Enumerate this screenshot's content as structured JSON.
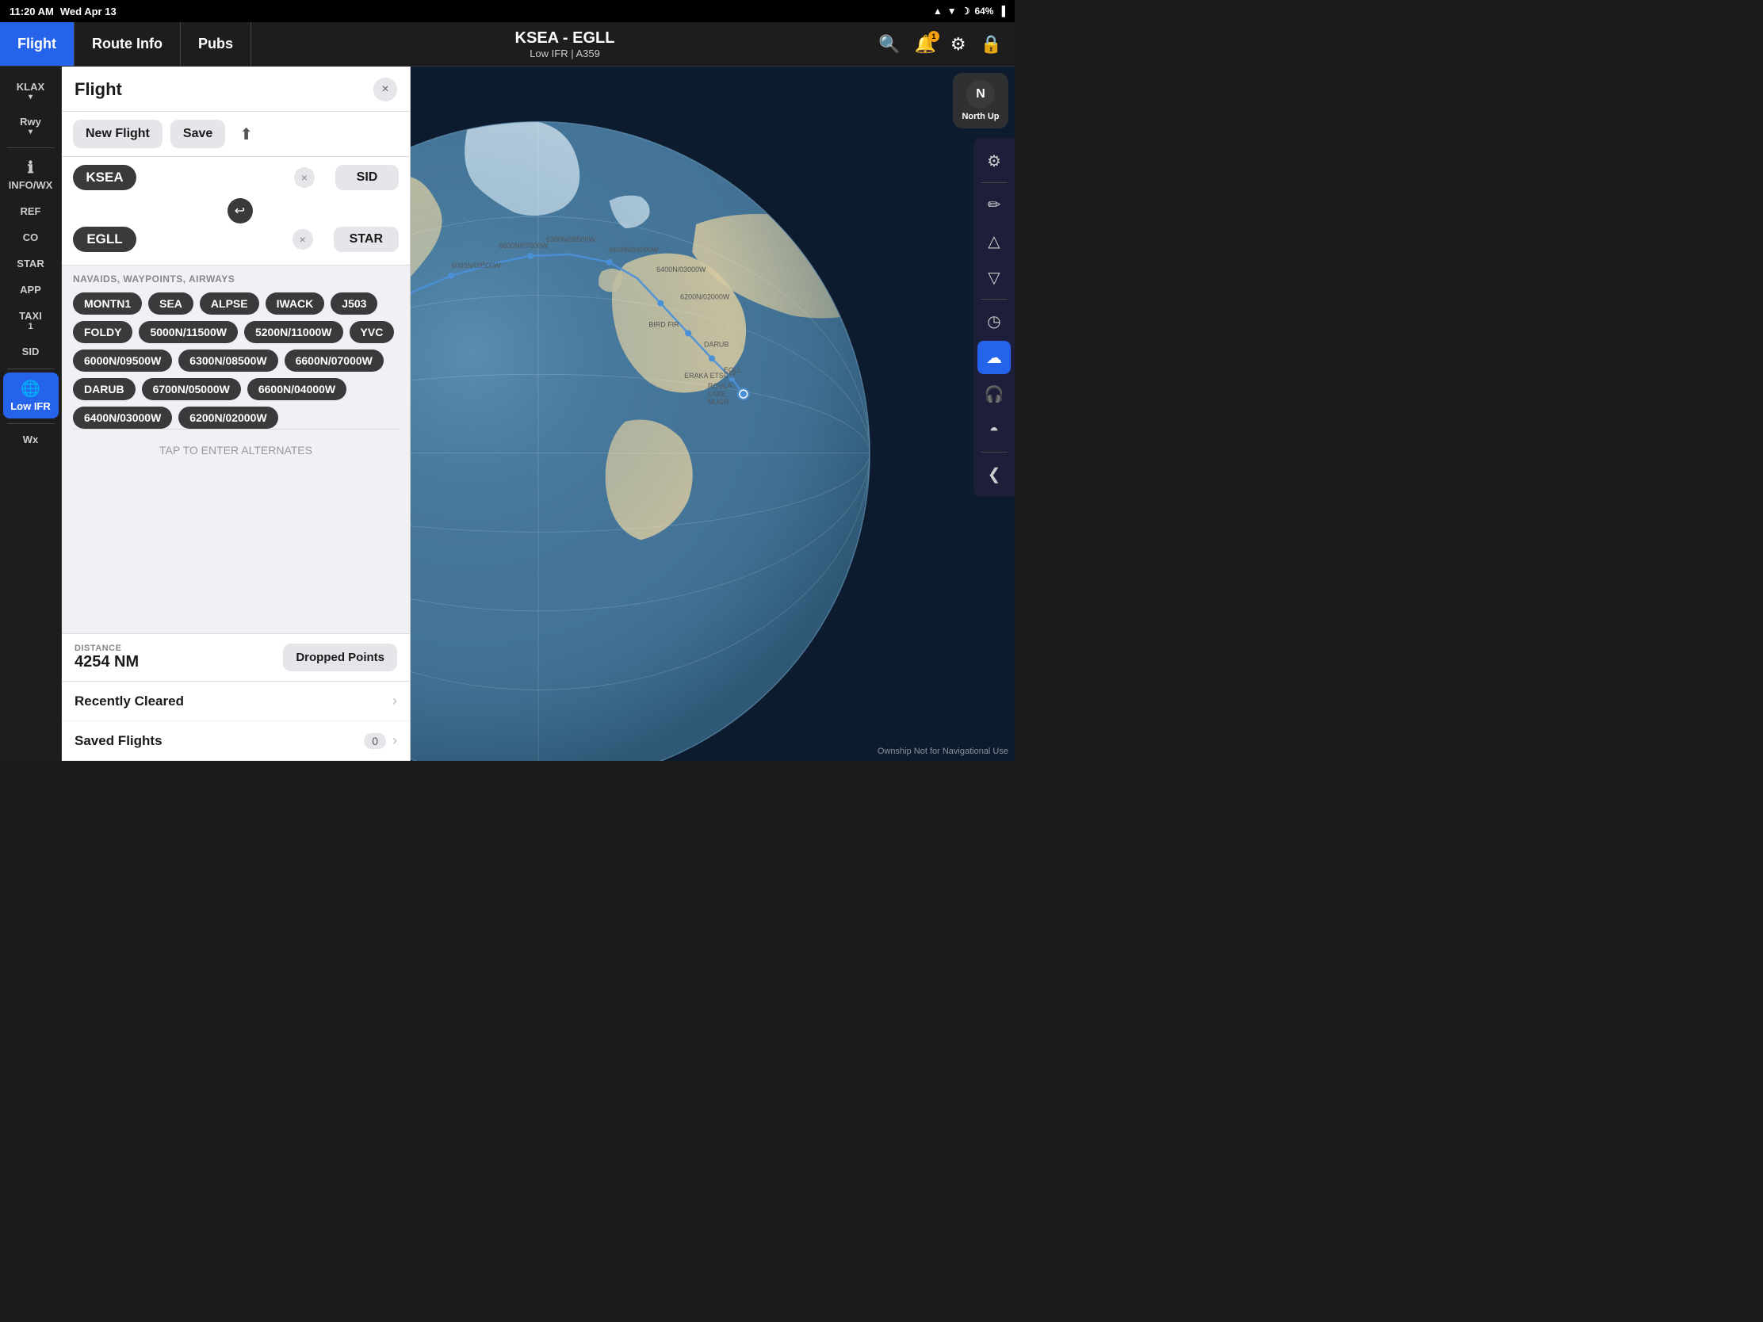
{
  "statusBar": {
    "time": "11:20 AM",
    "date": "Wed Apr 13",
    "battery": "64%",
    "batteryIcon": "🔋",
    "wifiIcon": "📶",
    "moonIcon": "🌙"
  },
  "navBar": {
    "tabs": [
      {
        "id": "flight",
        "label": "Flight",
        "active": true
      },
      {
        "id": "routeinfo",
        "label": "Route Info",
        "active": false
      },
      {
        "id": "pubs",
        "label": "Pubs",
        "active": false
      }
    ],
    "routeTitle": "KSEA - EGLL",
    "routeSub": "Low IFR | A359",
    "searchIcon": "🔍",
    "notifyIcon": "🔔",
    "settingsIcon": "⚙",
    "lockIcon": "🔒",
    "notifyBadge": "1"
  },
  "leftSidebar": {
    "items": [
      {
        "id": "klax",
        "label": "KLAX",
        "icon": "",
        "hasDropdown": true
      },
      {
        "id": "rwy",
        "label": "Rwy",
        "icon": "",
        "hasDropdown": true
      },
      {
        "id": "infowx",
        "label": "INFO/WX",
        "icon": "ℹ",
        "hasDropdown": false
      },
      {
        "id": "ref",
        "label": "REF",
        "icon": "",
        "hasDropdown": false
      },
      {
        "id": "co",
        "label": "CO",
        "icon": "",
        "hasDropdown": false
      },
      {
        "id": "star",
        "label": "STAR",
        "icon": "",
        "hasDropdown": false
      },
      {
        "id": "app",
        "label": "APP",
        "icon": "",
        "hasDropdown": false
      },
      {
        "id": "taxi",
        "label": "TAXI",
        "sub": "1",
        "icon": "",
        "hasDropdown": false
      },
      {
        "id": "sid",
        "label": "SID",
        "icon": "",
        "hasDropdown": false
      },
      {
        "id": "lowifr",
        "label": "Low IFR",
        "icon": "🌐",
        "hasDropdown": false,
        "active": true
      },
      {
        "id": "wx",
        "label": "Wx",
        "icon": "",
        "hasDropdown": false
      }
    ]
  },
  "flightPanel": {
    "title": "Flight",
    "closeLabel": "×",
    "newFlightLabel": "New Flight",
    "saveLabel": "Save",
    "shareIcon": "⬆",
    "origin": "KSEA",
    "destination": "EGLL",
    "sidLabel": "SID",
    "starLabel": "STAR",
    "swapIcon": "↩",
    "waypointsLabel": "NAVAIDS, WAYPOINTS, AIRWAYS",
    "waypoints": [
      "MONTN1",
      "SEA",
      "ALPSE",
      "IWACK",
      "J503",
      "FOLDY",
      "5000N/11500W",
      "5200N/11000W",
      "YVC",
      "6000N/09500W",
      "6300N/08500W",
      "6600N/07000W",
      "DARUB",
      "6700N/05000W",
      "6600N/04000W",
      "6400N/03000W",
      "6200N/02000W"
    ],
    "alternatesText": "TAP TO ENTER ALTERNATES",
    "distanceLabel": "DISTANCE",
    "distanceValue": "4254 NM",
    "droppedPointsLabel": "Dropped Points",
    "recentlyClearedLabel": "Recently Cleared",
    "savedFlightsLabel": "Saved Flights",
    "savedFlightsCount": "0"
  },
  "northUp": {
    "compassN": "N",
    "label": "North Up"
  },
  "rightToolbar": {
    "tools": [
      {
        "id": "gear",
        "icon": "⚙",
        "active": false
      },
      {
        "id": "pen",
        "icon": "✏",
        "active": false
      },
      {
        "id": "triangle-up",
        "icon": "△",
        "active": false
      },
      {
        "id": "triangle-down",
        "icon": "▽",
        "active": false
      },
      {
        "id": "clock",
        "icon": "◷",
        "active": false
      },
      {
        "id": "cloud",
        "icon": "☁",
        "active": true
      },
      {
        "id": "headphone",
        "icon": "🎧",
        "active": false
      },
      {
        "id": "semicircle",
        "icon": "◓",
        "active": false
      }
    ]
  },
  "watermark": "Ownship Not for Navigational Use",
  "collapseIcon": "❮"
}
